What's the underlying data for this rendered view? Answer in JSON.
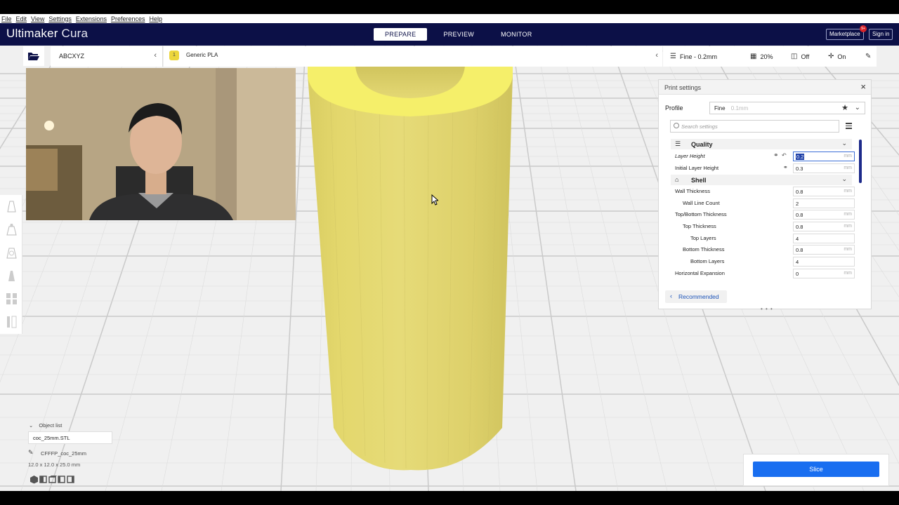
{
  "menu": [
    "File",
    "Edit",
    "View",
    "Settings",
    "Extensions",
    "Preferences",
    "Help"
  ],
  "app": {
    "brand": "Ultimaker",
    "brand_light": "Cura"
  },
  "stages": [
    {
      "label": "PREPARE",
      "active": true
    },
    {
      "label": "PREVIEW",
      "active": false
    },
    {
      "label": "MONITOR",
      "active": false
    }
  ],
  "header_buttons": {
    "marketplace": "Marketplace",
    "marketplace_badge": "9+",
    "signin": "Sign in"
  },
  "toolbar": {
    "printer": "ABCXYZ",
    "material_index": "1",
    "material": "Generic PLA",
    "profile_summary": "Fine - 0.2mm",
    "infill": "20%",
    "support": "Off",
    "adhesion": "On"
  },
  "print_settings": {
    "title": "Print settings",
    "profile_label": "Profile",
    "profile_value": "Fine",
    "profile_sub": "0.1mm",
    "search_placeholder": "Search settings",
    "recommended": "Recommended",
    "categories": [
      {
        "name": "Quality",
        "icon": "quality-icon"
      },
      {
        "name": "Shell",
        "icon": "shell-icon"
      }
    ],
    "rows": [
      {
        "label": "Layer Height",
        "value": "0.2",
        "unit": "mm",
        "italic": true,
        "indent": 0,
        "linked": true,
        "resettable": true,
        "focused": true
      },
      {
        "label": "Initial Layer Height",
        "value": "0.3",
        "unit": "mm",
        "indent": 0,
        "linked": true
      },
      {
        "label": "Wall Thickness",
        "value": "0.8",
        "unit": "mm",
        "indent": 0
      },
      {
        "label": "Wall Line Count",
        "value": "2",
        "unit": "",
        "indent": 1
      },
      {
        "label": "Top/Bottom Thickness",
        "value": "0.8",
        "unit": "mm",
        "indent": 0
      },
      {
        "label": "Top Thickness",
        "value": "0.8",
        "unit": "mm",
        "indent": 1
      },
      {
        "label": "Top Layers",
        "value": "4",
        "unit": "",
        "indent": 2
      },
      {
        "label": "Bottom Thickness",
        "value": "0.8",
        "unit": "mm",
        "indent": 1
      },
      {
        "label": "Bottom Layers",
        "value": "4",
        "unit": "",
        "indent": 2
      },
      {
        "label": "Horizontal Expansion",
        "value": "0",
        "unit": "mm",
        "indent": 0
      }
    ]
  },
  "object_list": {
    "header": "Object list",
    "file": "coc_25mm.STL",
    "object_name": "CFFFP_coc_25mm",
    "dimensions": "12.0 x 12.0 x 25.0 mm"
  },
  "slice_button": "Slice",
  "colors": {
    "header_bg": "#0c1047",
    "accent_blue": "#196ef0",
    "model_yellow": "#e6dc6e",
    "model_top": "#f5ef6a"
  }
}
